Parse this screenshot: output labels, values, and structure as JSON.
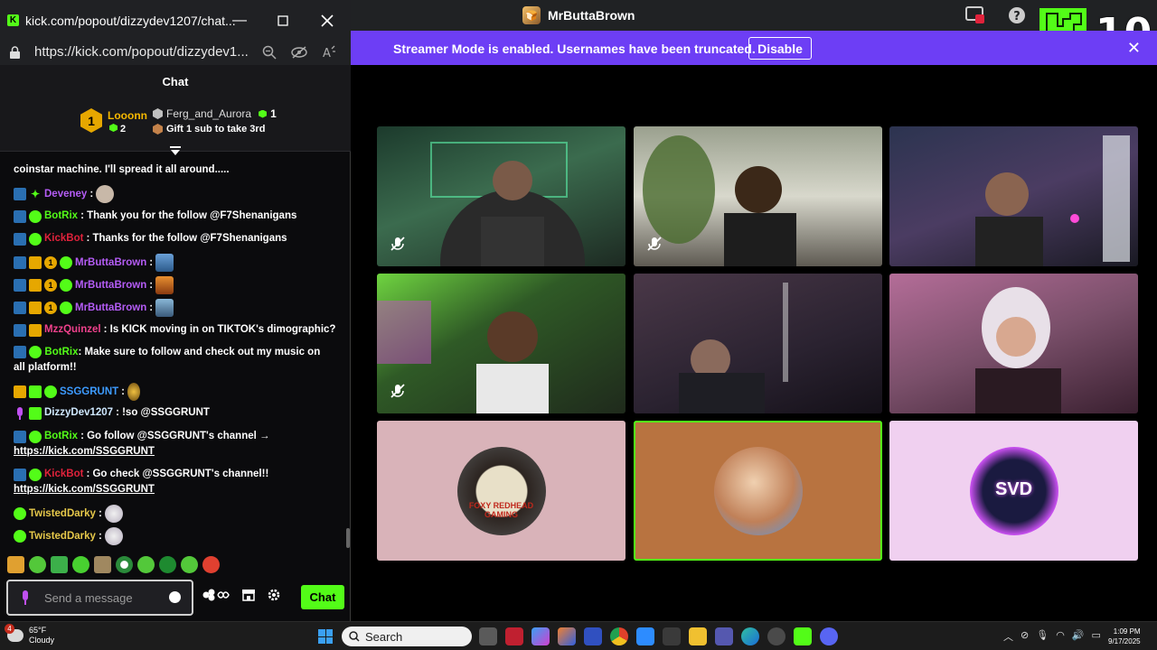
{
  "main_window": {
    "title": "MrButtaBrown",
    "kick_badge_number": "10",
    "banner": {
      "text": "Streamer Mode is enabled. Usernames have been truncated.",
      "button": "Disable",
      "close": "✕"
    }
  },
  "popout": {
    "title": "kick.com/popout/dizzydev1207/chat...",
    "url": "https://kick.com/popout/dizzydev1...",
    "chat_header": "Chat",
    "leaderboard": {
      "first_name": "Looonn",
      "first_rank": "1",
      "first_count": "2",
      "second_name": "Ferg_and_Aurora",
      "second_count": "1",
      "third_text": "Gift 1 sub to take 3rd"
    },
    "messages": [
      {
        "user": "",
        "text": "coinstar machine. I'll spread it all around.....",
        "color": "#ffffff"
      },
      {
        "user": "Deveney",
        "text": ":",
        "color": "#b45cf5"
      },
      {
        "user": "BotRix",
        "text": ": Thank you for the follow @F7Shenanigans",
        "color": "#53fc18"
      },
      {
        "user": "KickBot",
        "text": ": Thanks for the follow @F7Shenanigans",
        "color": "#e0223b"
      },
      {
        "user": "MrButtaBrown",
        "text": ":",
        "color": "#b45cf5"
      },
      {
        "user": "MrButtaBrown",
        "text": ":",
        "color": "#b45cf5"
      },
      {
        "user": "MrButtaBrown",
        "text": ":",
        "color": "#b45cf5"
      },
      {
        "user": "MzzQuinzel",
        "text": ": Is KICK moving in on TIKTOK's dimographic?",
        "color": "#f0418c"
      },
      {
        "user": "BotRix",
        "text": ": Make sure to follow and check out my music on all platform!!",
        "color": "#53fc18"
      },
      {
        "user": "SSGGRUNT",
        "text": ":",
        "color": "#3d9bff"
      },
      {
        "user": "DizzyDev1207",
        "text": ": !so @SSGGRUNT",
        "color": "#cfe8ff"
      },
      {
        "user": "BotRix",
        "text": ": Go follow @SSGGRUNT's channel →",
        "link": "https://kick.com/SSGGRUNT",
        "color": "#53fc18"
      },
      {
        "user": "KickBot",
        "text": ": Go check @SSGGRUNT's channel!!",
        "link": "https://kick.com/SSGGRUNT",
        "color": "#e0223b"
      },
      {
        "user": "TwistedDarky",
        "text": ":",
        "color": "#e6c84a"
      },
      {
        "user": "TwistedDarky",
        "text": ":",
        "color": "#e6c84a"
      }
    ],
    "input_placeholder": "Send a message",
    "send_button": "Chat"
  },
  "taskbar": {
    "weather_temp": "65°F",
    "weather_desc": "Cloudy",
    "weather_badge": "4",
    "search": "Search",
    "time": "1:09 PM",
    "date": "9/17/2025"
  },
  "tiles": [
    {
      "type": "video",
      "muted": true,
      "bg": "#2c4b3d"
    },
    {
      "type": "video",
      "muted": true,
      "bg": "#7a7e6e"
    },
    {
      "type": "video",
      "muted": false,
      "bg": "#3a3a52"
    },
    {
      "type": "video",
      "muted": true,
      "bg": "#3d6b2f"
    },
    {
      "type": "video",
      "muted": false,
      "bg": "#3a3040"
    },
    {
      "type": "video",
      "muted": false,
      "bg": "#a06a8a"
    },
    {
      "type": "avatar",
      "bg": "#d9b3b9",
      "label": "FOXY REDHEAD GAMING"
    },
    {
      "type": "avatar",
      "bg": "#b87340",
      "label": ""
    },
    {
      "type": "avatar",
      "bg": "#f0d0f0",
      "label": "SVD"
    }
  ]
}
